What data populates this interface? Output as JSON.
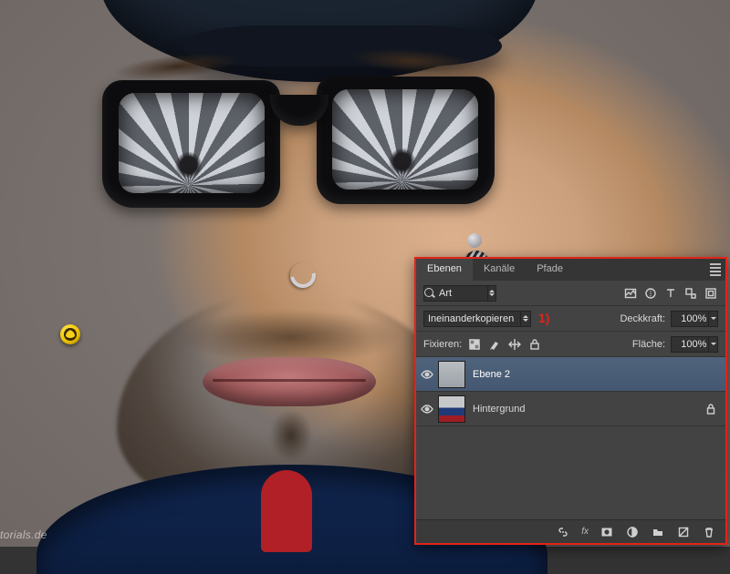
{
  "watermark": "torials.de",
  "panel": {
    "tabs": {
      "layers": "Ebenen",
      "channels": "Kanäle",
      "paths": "Pfade"
    },
    "filter": {
      "kind": "Art"
    },
    "blend": {
      "mode": "Ineinanderkopieren",
      "annotation": "1)",
      "opacity_label": "Deckkraft:",
      "opacity_value": "100%"
    },
    "lockrow": {
      "label": "Fixieren:",
      "fill_label": "Fläche:",
      "fill_value": "100%"
    },
    "layers": [
      {
        "name": "Ebene 2",
        "visible": true,
        "selected": true,
        "locked": false
      },
      {
        "name": "Hintergrund",
        "visible": true,
        "selected": false,
        "locked": true
      }
    ],
    "footer": {
      "fx": "fx"
    }
  }
}
